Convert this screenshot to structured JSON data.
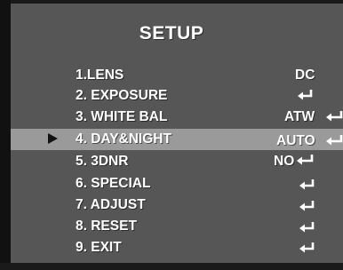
{
  "menu": {
    "title": "SETUP",
    "items": [
      {
        "label": "1.LENS",
        "value": "DC",
        "icon": ""
      },
      {
        "label": "2. EXPOSURE",
        "value": "",
        "icon": "enter-icon"
      },
      {
        "label": "3. WHITE BAL",
        "value": "ATW",
        "icon": "enter-icon"
      },
      {
        "label": "4. DAY&NIGHT",
        "value": "AUTO",
        "icon": "enter-icon"
      },
      {
        "label": "5. 3DNR",
        "value": "NO",
        "icon": "enter-icon"
      },
      {
        "label": "6. SPECIAL",
        "value": "",
        "icon": "enter-icon"
      },
      {
        "label": "7. ADJUST",
        "value": "",
        "icon": "enter-icon"
      },
      {
        "label": "8. RESET",
        "value": "",
        "icon": "enter-icon"
      },
      {
        "label": "9. EXIT",
        "value": "",
        "icon": "enter-icon"
      }
    ],
    "selected_index": 3,
    "cursor_icon": "right-triangle-cursor-icon"
  },
  "colors": {
    "background": "#565656",
    "highlight": "#9a9a9a",
    "text": "#ffffff",
    "cursor": "#111111"
  }
}
